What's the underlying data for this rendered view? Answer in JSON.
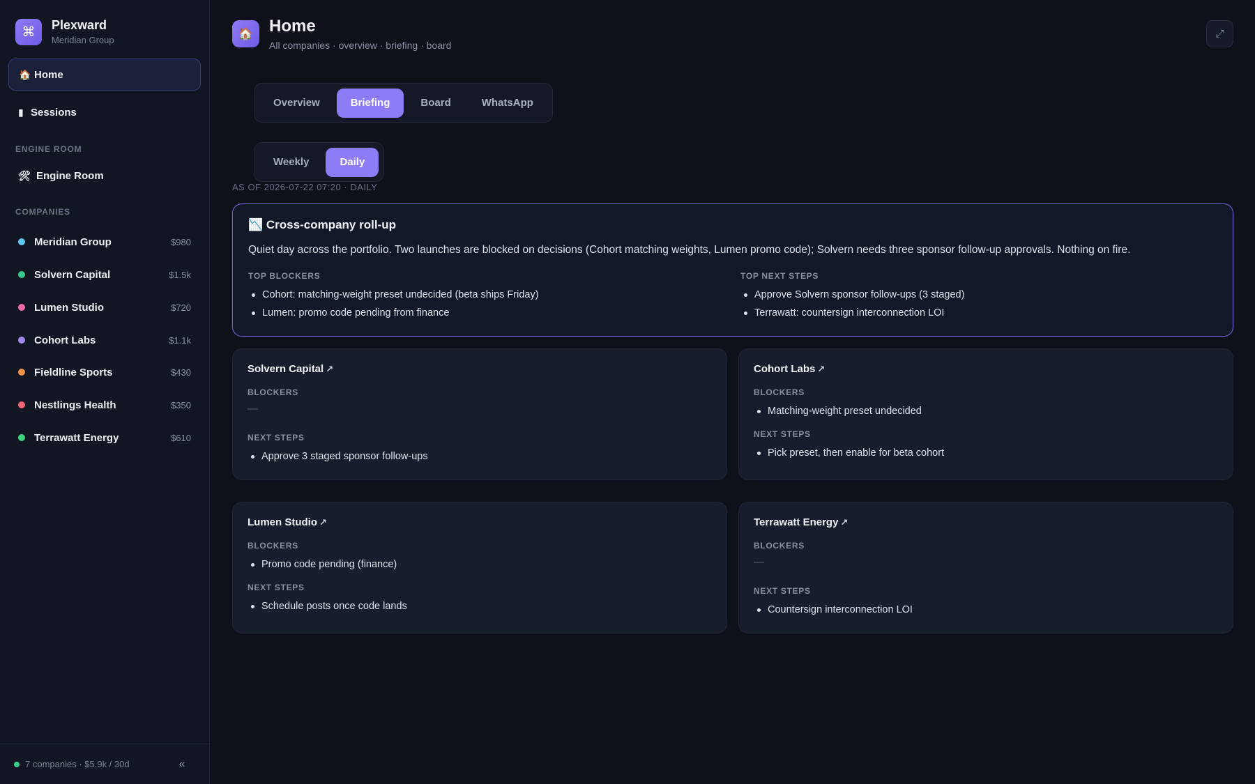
{
  "brand": {
    "logo_glyph": "⌘",
    "name": "Plexward",
    "org": "Meridian Group"
  },
  "nav": {
    "home": {
      "icon": "🏠",
      "label": "Home"
    },
    "sessions": {
      "icon": "▮",
      "label": "Sessions"
    },
    "engine_section": "ENGINE ROOM",
    "engine": {
      "icon": "🛠",
      "label": "Engine Room"
    },
    "companies_section": "COMPANIES"
  },
  "companies": [
    {
      "name": "Meridian Group",
      "cost": "$980",
      "color": "#5fc6f0"
    },
    {
      "name": "Solvern Capital",
      "cost": "$1.5k",
      "color": "#35c98a"
    },
    {
      "name": "Lumen Studio",
      "cost": "$720",
      "color": "#ee6aa7"
    },
    {
      "name": "Cohort Labs",
      "cost": "$1.1k",
      "color": "#a589f0"
    },
    {
      "name": "Fieldline Sports",
      "cost": "$430",
      "color": "#f2924a"
    },
    {
      "name": "Nestlings Health",
      "cost": "$350",
      "color": "#f06373"
    },
    {
      "name": "Terrawatt Energy",
      "cost": "$610",
      "color": "#3dd37b"
    }
  ],
  "footer": {
    "summary": "7 companies · $5.9k / 30d",
    "collapse_glyph": "«"
  },
  "header": {
    "icon": "🏠",
    "title": "Home",
    "subtitle": "All companies · overview · briefing · board",
    "expand_glyph": "⤢"
  },
  "tabs": [
    "Overview",
    "Briefing",
    "Board",
    "WhatsApp"
  ],
  "active_tab": "Briefing",
  "periods": [
    "Weekly",
    "Daily"
  ],
  "active_period": "Daily",
  "as_of": "AS OF 2026-07-22 07:20 · DAILY",
  "rollup": {
    "icon": "📉",
    "title": "Cross-company roll-up",
    "summary": "Quiet day across the portfolio. Two launches are blocked on decisions (Cohort matching weights, Lumen promo code); Solvern needs three sponsor follow-up approvals. Nothing on fire.",
    "blockers_label": "TOP BLOCKERS",
    "blockers": [
      "Cohort: matching-weight preset undecided (beta ships Friday)",
      "Lumen: promo code pending from finance"
    ],
    "next_label": "TOP NEXT STEPS",
    "next_steps": [
      "Approve Solvern sponsor follow-ups (3 staged)",
      "Terrawatt: countersign interconnection LOI"
    ]
  },
  "cards": [
    {
      "title": "Solvern Capital",
      "arrow": "↗",
      "blockers_label": "BLOCKERS",
      "blockers": [],
      "empty": "—",
      "next_label": "NEXT STEPS",
      "next_steps": [
        "Approve 3 staged sponsor follow-ups"
      ]
    },
    {
      "title": "Cohort Labs",
      "arrow": "↗",
      "blockers_label": "BLOCKERS",
      "blockers": [
        "Matching-weight preset undecided"
      ],
      "empty": "—",
      "next_label": "NEXT STEPS",
      "next_steps": [
        "Pick preset, then enable for beta cohort"
      ]
    },
    {
      "title": "Lumen Studio",
      "arrow": "↗",
      "blockers_label": "BLOCKERS",
      "blockers": [
        "Promo code pending (finance)"
      ],
      "empty": "—",
      "next_label": "NEXT STEPS",
      "next_steps": [
        "Schedule posts once code lands"
      ]
    },
    {
      "title": "Terrawatt Energy",
      "arrow": "↗",
      "blockers_label": "BLOCKERS",
      "blockers": [],
      "empty": "—",
      "next_label": "NEXT STEPS",
      "next_steps": [
        "Countersign interconnection LOI"
      ]
    }
  ]
}
